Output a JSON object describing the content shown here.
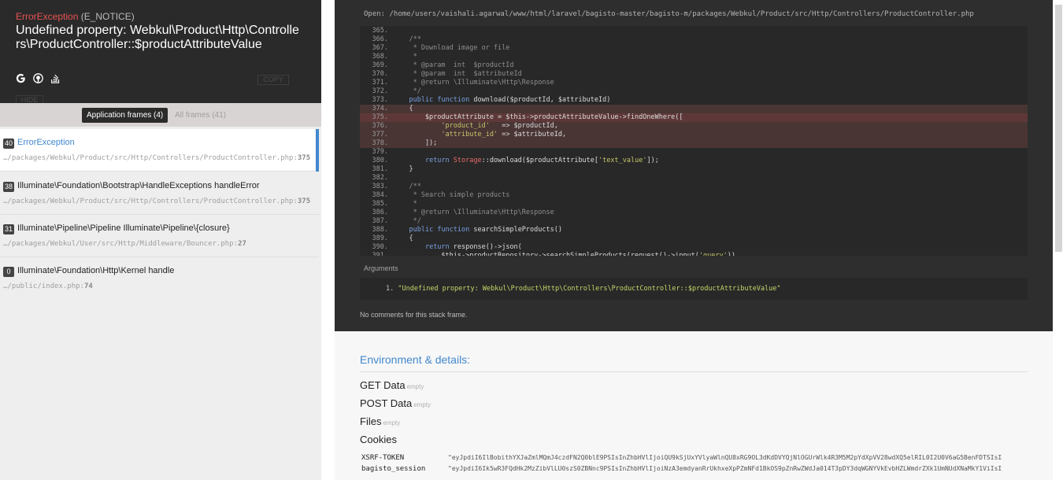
{
  "exception": {
    "class": "ErrorException",
    "code": "(E_NOTICE)",
    "message": "Undefined property: Webkul\\Product\\Http\\Controllers\\ProductController::$productAttributeValue",
    "copy_label": "COPY",
    "hide_label": "HIDE",
    "search_icons": [
      "google-icon",
      "duckduckgo-icon",
      "stackoverflow-icon"
    ]
  },
  "tabs": {
    "application": "Application frames (4)",
    "all": "All frames (41)"
  },
  "frames": [
    {
      "index": "40",
      "title": "ErrorException",
      "path": "…/packages/Webkul/Product/src/Http/Controllers/ProductController.php",
      "line": "375",
      "active": true
    },
    {
      "index": "38",
      "title": "Illuminate\\Foundation\\Bootstrap\\HandleExceptions handleError",
      "path": "…/packages/Webkul/Product/src/Http/Controllers/ProductController.php",
      "line": "375",
      "active": false
    },
    {
      "index": "31",
      "title": "Illuminate\\Pipeline\\Pipeline Illuminate\\Pipeline\\{closure}",
      "path": "…/packages/Webkul/User/src/Http/Middleware/Bouncer.php",
      "line": "27",
      "active": false
    },
    {
      "index": "0",
      "title": "Illuminate\\Foundation\\Http\\Kernel handle",
      "path": "…/public/index.php",
      "line": "74",
      "active": false
    }
  ],
  "file_open": "Open: /home/users/vaishali.agarwal/www/html/laravel/bagisto-master/bagisto-m/packages/Webkul/Product/src/Http/Controllers/ProductController.php",
  "code": [
    {
      "n": "365.",
      "t": ""
    },
    {
      "n": "366.",
      "t": "    /**"
    },
    {
      "n": "367.",
      "t": "     * Download image or file"
    },
    {
      "n": "368.",
      "t": "     *"
    },
    {
      "n": "369.",
      "t": "     * @param  int  $productId"
    },
    {
      "n": "370.",
      "t": "     * @param  int  $attributeId"
    },
    {
      "n": "371.",
      "t": "     * @return \\Illuminate\\Http\\Response"
    },
    {
      "n": "372.",
      "t": "     */"
    },
    {
      "n": "373.",
      "t": "    public function download($productId, $attributeId)"
    },
    {
      "n": "374.",
      "t": "    {"
    },
    {
      "n": "375.",
      "t": "        $productAttribute = $this->productAttributeValue->findOneWhere(["
    },
    {
      "n": "376.",
      "t": "            'product_id'   => $productId,"
    },
    {
      "n": "377.",
      "t": "            'attribute_id' => $attributeId,"
    },
    {
      "n": "378.",
      "t": "        ]);"
    },
    {
      "n": "379.",
      "t": ""
    },
    {
      "n": "380.",
      "t": "        return Storage::download($productAttribute['text_value']);"
    },
    {
      "n": "381.",
      "t": "    }"
    },
    {
      "n": "382.",
      "t": ""
    },
    {
      "n": "383.",
      "t": "    /**"
    },
    {
      "n": "384.",
      "t": "     * Search simple products"
    },
    {
      "n": "385.",
      "t": "     *"
    },
    {
      "n": "386.",
      "t": "     * @return \\Illuminate\\Http\\Response"
    },
    {
      "n": "387.",
      "t": "     */"
    },
    {
      "n": "388.",
      "t": "    public function searchSimpleProducts()"
    },
    {
      "n": "389.",
      "t": "    {"
    },
    {
      "n": "390.",
      "t": "        return response()->json("
    },
    {
      "n": "391.",
      "t": "            $this->productRepository->searchSimpleProducts(request()->input('query'))"
    }
  ],
  "arguments": {
    "label": "Arguments",
    "item_number": "1.",
    "value": "\"Undefined property: Webkul\\Product\\Http\\Controllers\\ProductController::$productAttributeValue\""
  },
  "no_comments": "No comments for this stack frame.",
  "environment": {
    "title": "Environment & details:",
    "sections": [
      {
        "name": "GET Data",
        "empty": "empty"
      },
      {
        "name": "POST Data",
        "empty": "empty"
      },
      {
        "name": "Files",
        "empty": "empty"
      },
      {
        "name": "Cookies",
        "empty": ""
      }
    ],
    "cookies": [
      {
        "key": "XSRF-TOKEN",
        "value": "\"eyJpdiI6IlBobithYXJaZmlMQmJ4czdFN2Q0blE9PSIsInZhbHVlIjoiQU9kSjUxYVlyaWlnQU8xRG9OL3dKdDVYQjNlOGUrWlk4R3M5M2pYdXpVV28wdXQ5elRIL0I2U0V6aG5BenFDTSIsI"
      },
      {
        "key": "bagisto_session",
        "value": "\"eyJpdiI6Ik5wR3FQdHk2MzZibVlLU0szS0ZBNnc9PSIsInZhbHVlIjoiNzA3emdyanRrUkhxeXpPZmNFd1BkOS9pZnRwZWdJa014T3pDY3dqWGNYVkEvbHZLWmdrZXk1UmNUdXNaMkY1ViIsI"
      }
    ]
  }
}
